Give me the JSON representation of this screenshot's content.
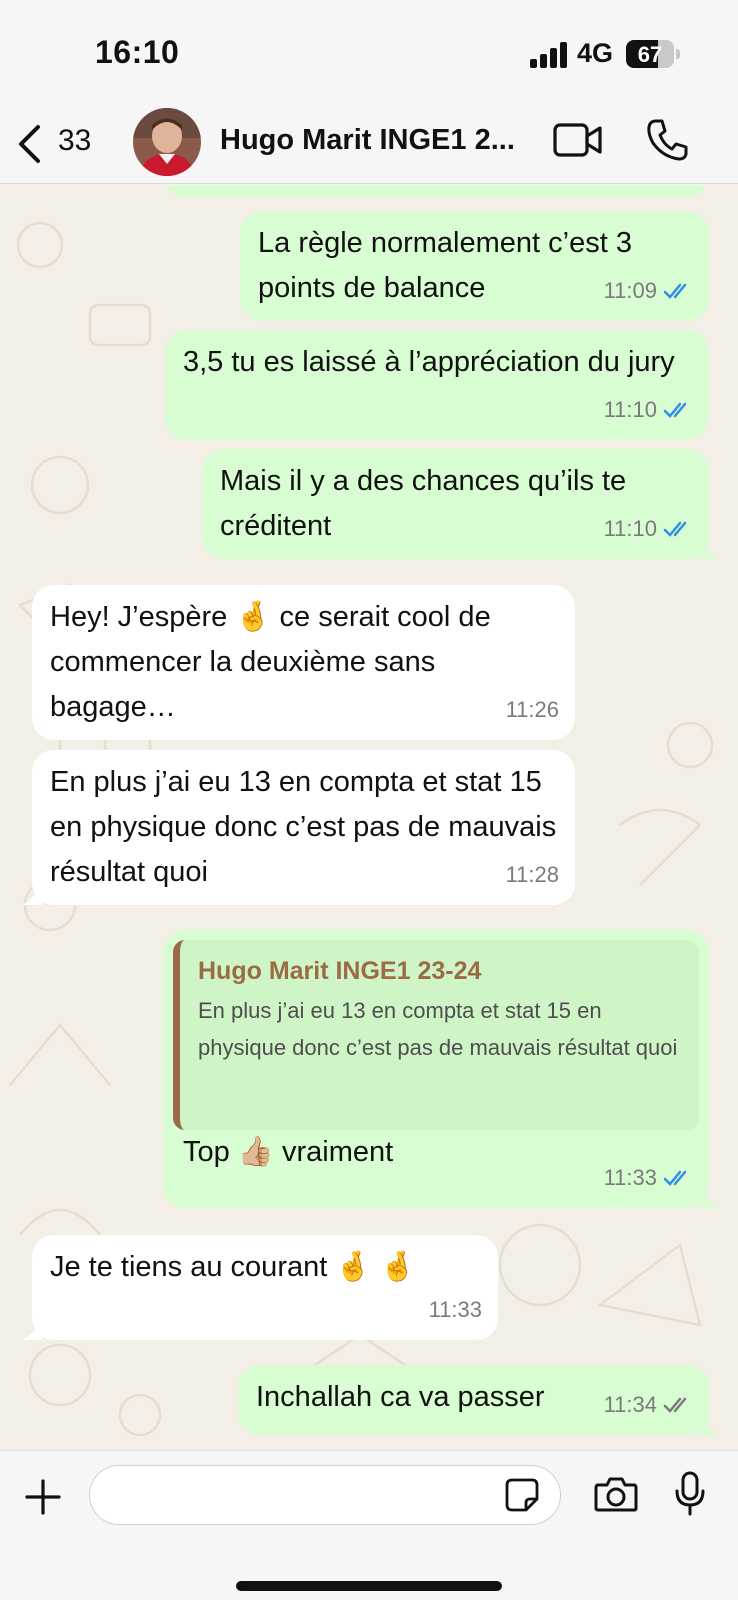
{
  "status_bar": {
    "time": "16:10",
    "network": "4G",
    "battery_level": "67",
    "battery_fraction": 0.67
  },
  "header": {
    "back_count": "33",
    "contact_name": "Hugo Marit INGE1 2...",
    "icons": [
      "chevron-left-icon",
      "video-camera-icon",
      "phone-icon"
    ]
  },
  "messages": [
    {
      "direction": "out",
      "text": "La règle normalement c’est 3 points de balance",
      "time": "11:09",
      "status": "read"
    },
    {
      "direction": "out",
      "text": "3,5 tu es laissé à l’appréciation du jury",
      "time": "11:10",
      "status": "read"
    },
    {
      "direction": "out",
      "text": "Mais il y a des chances qu’ils te créditent",
      "time": "11:10",
      "status": "read"
    },
    {
      "direction": "in",
      "text": "Hey! J’espère 🤞 ce serait cool de commencer la deuxième sans bagage…",
      "time": "11:26"
    },
    {
      "direction": "in",
      "text": "En plus j’ai eu 13 en compta et stat 15 en physique donc c’est pas de mauvais résultat quoi",
      "time": "11:28"
    },
    {
      "direction": "out",
      "quote_author": "Hugo Marit INGE1 23-24",
      "quote_text": "En plus j’ai eu 13 en compta et stat 15 en physique donc c’est pas de mauvais résultat quoi",
      "text": "Top 👍🏼 vraiment",
      "time": "11:33",
      "status": "read"
    },
    {
      "direction": "in",
      "text": "Je te tiens au courant 🤞 🤞",
      "time": "11:33"
    },
    {
      "direction": "out",
      "text": "Inchallah ca va passer",
      "time": "11:34",
      "status": "delivered"
    }
  ],
  "input_bar": {
    "placeholder": "",
    "icons": [
      "plus-icon",
      "sticker-icon",
      "camera-icon",
      "microphone-icon"
    ]
  },
  "colors": {
    "outgoing_bubble": "#d9fdd3",
    "incoming_bubble": "#ffffff",
    "read_ticks": "#2f8ee6",
    "delivered_ticks": "#7a7a7a",
    "quote_accent": "#9b6b45"
  }
}
